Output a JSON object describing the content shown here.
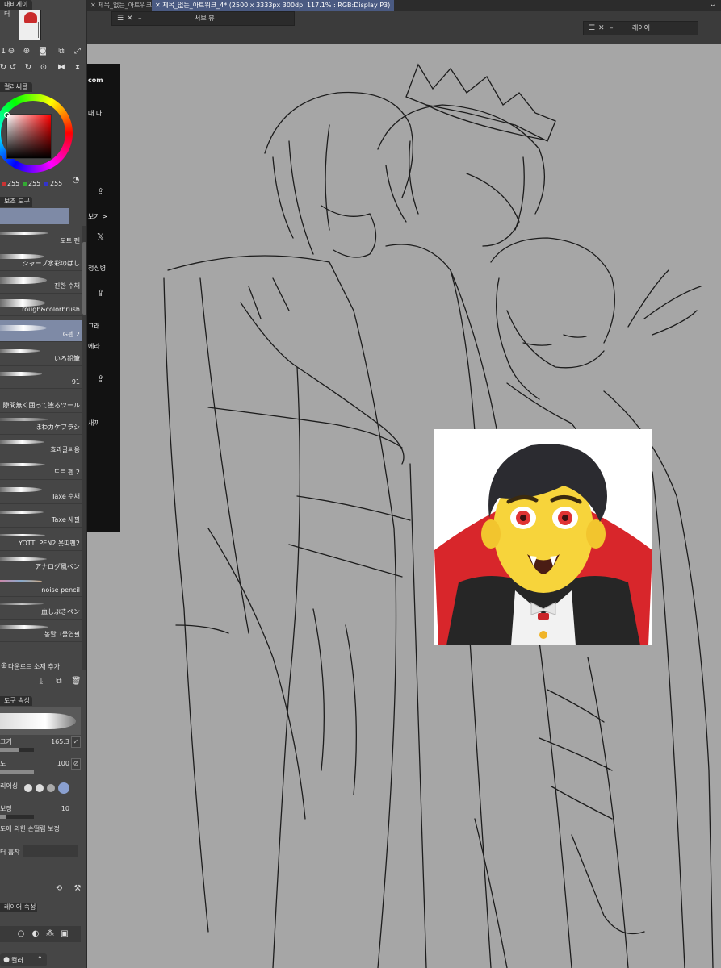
{
  "left_panel": {
    "navigator_tab": "내비게이터",
    "color_circle_tab": "컬러써클",
    "sub_tool_tab": "보조 도구",
    "tool_property_tab": "도구 속성",
    "layer_property_tab": "레이어 속성",
    "rgb": {
      "r": "255",
      "g": "255",
      "b": "255"
    },
    "brushes": [
      {
        "label": "도트 펜"
      },
      {
        "label": "シャープ水彩のばし"
      },
      {
        "label": "진한 수채"
      },
      {
        "label": "rough&colorbrush"
      },
      {
        "label": "G펜 2",
        "selected": true
      },
      {
        "label": "いろ鉛筆"
      },
      {
        "label": "91"
      },
      {
        "label": "隙間無く囲って塗るツール"
      },
      {
        "label": "ほわカケブラシ"
      },
      {
        "label": "효과글씨용"
      },
      {
        "label": "도트 펜 2"
      },
      {
        "label": "Taxe 수채"
      },
      {
        "label": "Taxe 세필"
      },
      {
        "label": "YOTTI PEN2 욧띠펜2"
      },
      {
        "label": "アナログ風ペン"
      },
      {
        "label": "noise pencil"
      },
      {
        "label": "血しぶきペン"
      },
      {
        "label": "농말그물연필"
      }
    ],
    "download_label": "다운로드 소재 추가",
    "props": {
      "size_label": "크기",
      "size_value": "165.3",
      "size_fraction": 0.55,
      "density_label": "도",
      "density_value": "100",
      "antialias_label": "리어싱",
      "correction_label": "보정",
      "correction_value": "10",
      "speed_correction_label": "도에 의한 손떨림 보정",
      "filter_label": "터 흡착"
    },
    "color_label": "컬러"
  },
  "top_bar": {
    "tabs": [
      {
        "label": "제목_없는_아트워크",
        "active": false
      },
      {
        "label": "제목_없는_아트워크_4* (2500 x 3333px 300dpi 117.1% : RGB:Display P3)",
        "active": true
      }
    ],
    "sub_view_title": "서브 뷰",
    "layer_title": "레이어"
  },
  "overlay_strip": {
    "texts": [
      "com",
      "때 다",
      "보기 >",
      "정신병",
      "그래",
      "에라",
      "새끼"
    ],
    "x_icon": "𝕏"
  },
  "icons": {
    "close": "✕",
    "menu": "☰",
    "minimize": "–",
    "chevron_down": "⌄"
  }
}
